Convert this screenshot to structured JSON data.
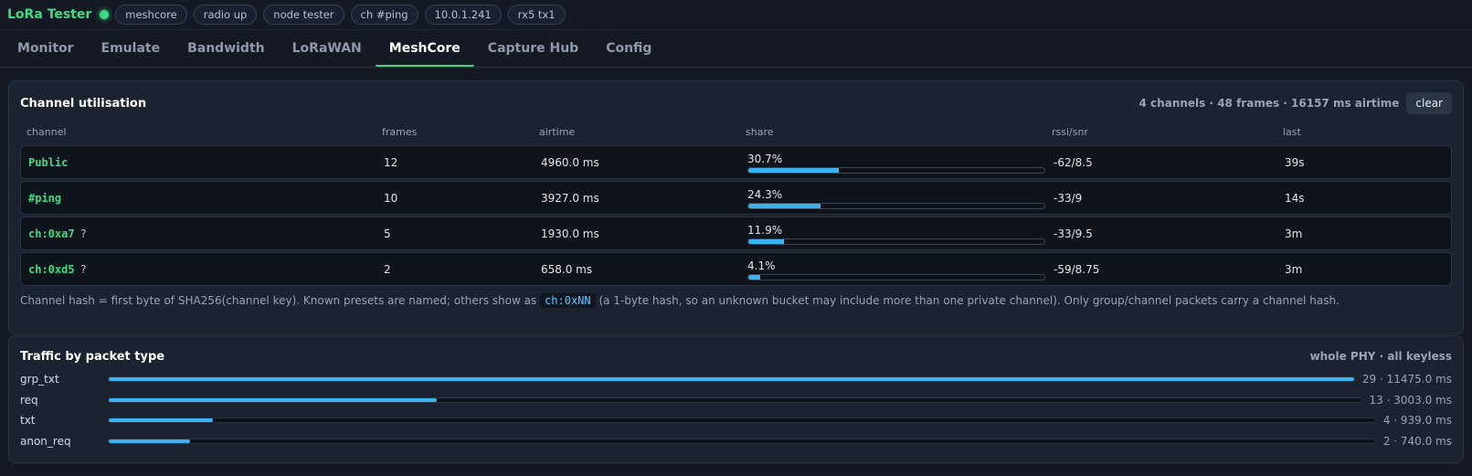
{
  "app": {
    "title": "LoRa Tester",
    "status_color": "#3ddc84",
    "pills": [
      "meshcore",
      "radio up",
      "node tester",
      "ch #ping",
      "10.0.1.241",
      "rx5 tx1"
    ]
  },
  "tabs": [
    {
      "label": "Monitor",
      "active": false
    },
    {
      "label": "Emulate",
      "active": false
    },
    {
      "label": "Bandwidth",
      "active": false
    },
    {
      "label": "LoRaWAN",
      "active": false
    },
    {
      "label": "MeshCore",
      "active": true
    },
    {
      "label": "Capture Hub",
      "active": false
    },
    {
      "label": "Config",
      "active": false
    }
  ],
  "channel_util": {
    "title": "Channel utilisation",
    "summary": "4 channels · 48 frames · 16157 ms airtime",
    "clear_label": "clear",
    "columns": [
      "channel",
      "frames",
      "airtime",
      "share",
      "rssi/snr",
      "last"
    ],
    "rows": [
      {
        "channel": "Public",
        "unknown": "",
        "frames": "12",
        "airtime": "4960.0 ms",
        "share": "30.7%",
        "share_pct": 30.7,
        "rssi_snr": "-62/8.5",
        "last": "39s"
      },
      {
        "channel": "#ping",
        "unknown": "",
        "frames": "10",
        "airtime": "3927.0 ms",
        "share": "24.3%",
        "share_pct": 24.3,
        "rssi_snr": "-33/9",
        "last": "14s"
      },
      {
        "channel": "ch:0xa7",
        "unknown": "?",
        "frames": "5",
        "airtime": "1930.0 ms",
        "share": "11.9%",
        "share_pct": 11.9,
        "rssi_snr": "-33/9.5",
        "last": "3m"
      },
      {
        "channel": "ch:0xd5",
        "unknown": "?",
        "frames": "2",
        "airtime": "658.0 ms",
        "share": "4.1%",
        "share_pct": 4.1,
        "rssi_snr": "-59/8.75",
        "last": "3m"
      }
    ],
    "note_before": "Channel hash = first byte of SHA256(channel key). Known presets are named; others show as",
    "note_code": "ch:0xNN",
    "note_after": "(a 1-byte hash, so an unknown bucket may include more than one private channel). Only group/channel packets carry a channel hash."
  },
  "traffic": {
    "title": "Traffic by packet type",
    "summary": "whole PHY · all keyless",
    "rows": [
      {
        "type": "grp_txt",
        "value": "29 · 11475.0 ms",
        "fraction": 1.0
      },
      {
        "type": "req",
        "value": "13 · 3003.0 ms",
        "fraction": 0.262
      },
      {
        "type": "txt",
        "value": "4 · 939.0 ms",
        "fraction": 0.082
      },
      {
        "type": "anon_req",
        "value": "2 · 740.0 ms",
        "fraction": 0.064
      }
    ]
  },
  "accent_color": "#3ab4f2"
}
